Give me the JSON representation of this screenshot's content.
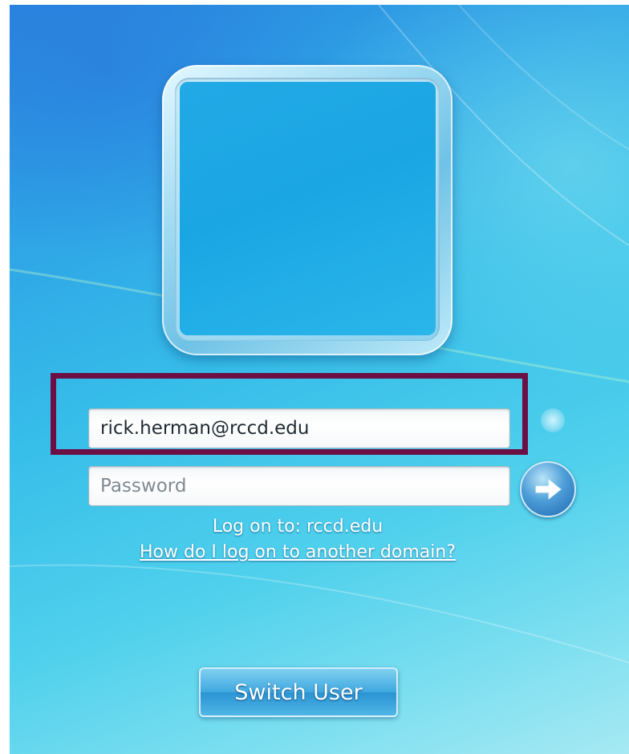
{
  "login": {
    "username_value": "rick.herman@rccd.edu",
    "password_placeholder": "Password",
    "logon_to_text": "Log on to: rccd.edu",
    "other_domain_link": "How do I log on to another domain?",
    "switch_user_label": "Switch User"
  },
  "icons": {
    "submit": "arrow-right-icon",
    "avatar": "user-picture-frame"
  },
  "colors": {
    "highlight_border": "#6c0f45",
    "background_accent": "#36bde9"
  }
}
